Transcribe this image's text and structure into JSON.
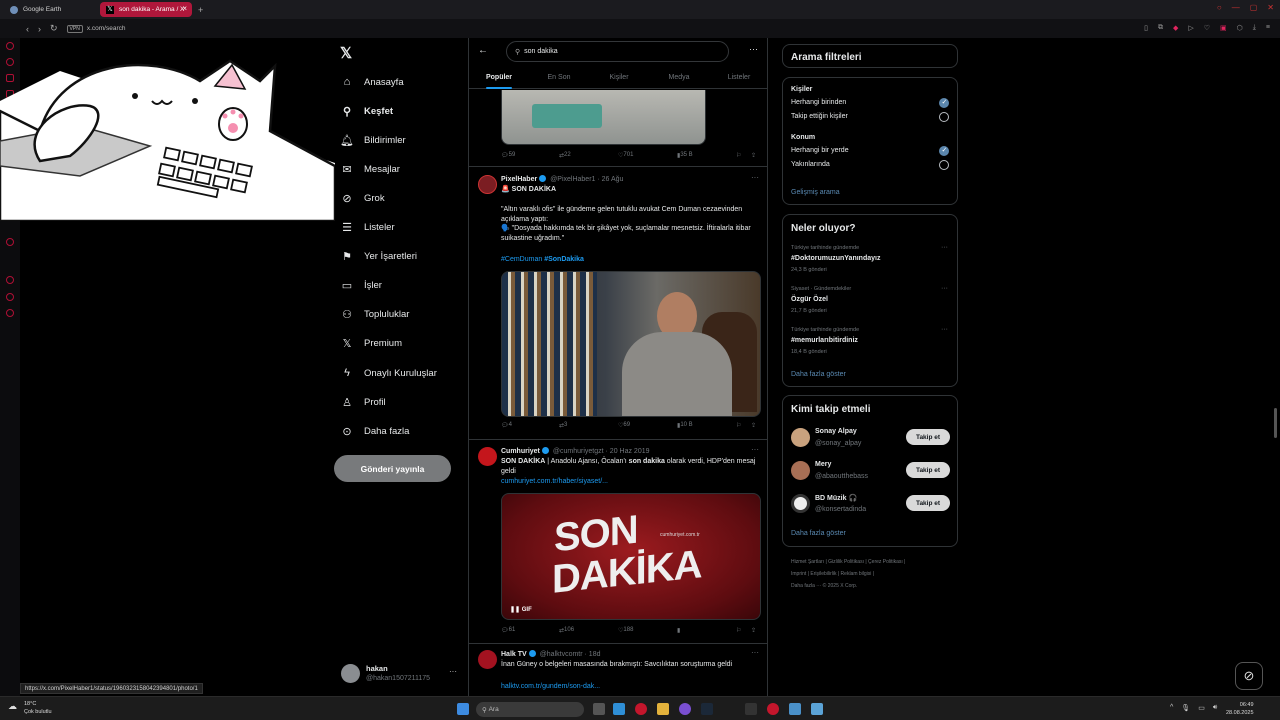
{
  "browser": {
    "tabs": [
      {
        "label": "Google Earth",
        "active": false
      },
      {
        "label": "son dakika - Arama / X",
        "active": true
      }
    ],
    "url": "x.com/search",
    "vpn_label": "VPN"
  },
  "nav": {
    "items": [
      {
        "label": "Anasayfa",
        "icon": "home-icon"
      },
      {
        "label": "Keşfet",
        "icon": "search-icon"
      },
      {
        "label": "Bildirimler",
        "icon": "bell-icon"
      },
      {
        "label": "Mesajlar",
        "icon": "mail-icon"
      },
      {
        "label": "Grok",
        "icon": "grok-icon"
      },
      {
        "label": "Listeler",
        "icon": "list-icon"
      },
      {
        "label": "Yer İşaretleri",
        "icon": "bookmark-icon"
      },
      {
        "label": "İşler",
        "icon": "briefcase-icon"
      },
      {
        "label": "Topluluklar",
        "icon": "people-icon"
      },
      {
        "label": "Premium",
        "icon": "x-logo-icon"
      },
      {
        "label": "Onaylı Kuruluşlar",
        "icon": "lightning-icon"
      },
      {
        "label": "Profil",
        "icon": "person-icon"
      },
      {
        "label": "Daha fazla",
        "icon": "more-circle-icon"
      }
    ],
    "post_button": "Gönderi yayınla",
    "account": {
      "name": "hakan",
      "handle": "@hakan1507211175"
    }
  },
  "search": {
    "query": "son dakika",
    "tabs": [
      "Popüler",
      "En Son",
      "Kişiler",
      "Medya",
      "Listeler"
    ],
    "active_tab": "Popüler"
  },
  "tweets": [
    {
      "actions": {
        "reply": "59",
        "retweet": "22",
        "like": "701",
        "views": "35 B"
      }
    },
    {
      "name": "PixelHaber",
      "handle": "@PixelHaber1 · 26 Ağu",
      "headline": "🚨 SON DAKİKA",
      "body": "\"Altın varaklı ofis\" ile gündeme gelen tutuklu avukat Cem Duman cezaevinden açıklama yaptı:",
      "quote": "🗣️ \"Dosyada hakkımda tek bir şikâyet yok, suçlamalar mesnetsiz. İftiralarla itibar suikastine uğradım.\"",
      "tag1": "#CemDuman",
      "tag2": "#SonDakika",
      "actions": {
        "reply": "4",
        "retweet": "3",
        "like": "69",
        "views": "10 B"
      }
    },
    {
      "name": "Cumhuriyet",
      "handle": "@cumhuriyetgzt · 20 Haz 2019",
      "body_prefix": "SON DAKİKA",
      "body_mid": " | Anadolu Ajansı, Öcalan'ı ",
      "body_bold": "son dakika",
      "body_suffix": " olarak verdi, HDP'den mesaj geldi",
      "link": "cumhuriyet.com.tr/haber/siyaset/...",
      "media_text_1": "SON",
      "media_text_2": "DAKİKA",
      "media_watermark": "cumhuriyet.com.tr",
      "gif_label": "GIF",
      "actions": {
        "reply": "61",
        "retweet": "106",
        "like": "188"
      }
    },
    {
      "name": "Halk TV",
      "handle": "@halktvcomtr · 18d",
      "body": "İnan Güney o belgeleri masasında bırakmıştı: Savcılıktan soruşturma geldi",
      "link": "halktv.com.tr/gundem/son-dak..."
    }
  ],
  "filters": {
    "title": "Arama filtreleri",
    "people_title": "Kişiler",
    "people_opts": [
      {
        "label": "Herhangi birinden",
        "selected": true
      },
      {
        "label": "Takip ettiğin kişiler",
        "selected": false
      }
    ],
    "location_title": "Konum",
    "location_opts": [
      {
        "label": "Herhangi bir yerde",
        "selected": true
      },
      {
        "label": "Yakınlarında",
        "selected": false
      }
    ],
    "advanced": "Gelişmiş arama"
  },
  "trends": {
    "title": "Neler oluyor?",
    "items": [
      {
        "meta": "Türkiye tarihinde gündemde",
        "name": "#DoktorumuzunYanındayız",
        "count": "24,3 B gönderi"
      },
      {
        "meta": "Siyaset · Gündemdekiler",
        "name": "Özgür Özel",
        "count": "21,7 B gönderi"
      },
      {
        "meta": "Türkiye tarihinde gündemde",
        "name": "#memurlarıbitirdiniz",
        "count": "18,4 B gönderi"
      }
    ],
    "more": "Daha fazla göster"
  },
  "who_to_follow": {
    "title": "Kimi takip etmeli",
    "items": [
      {
        "name": "Sonay Alpay",
        "handle": "@sonay_alpay",
        "button": "Takip et"
      },
      {
        "name": "Mery",
        "handle": "@abaoutthebass",
        "button": "Takip et"
      },
      {
        "name": "BD Müzik 🎧",
        "handle": "@konsertadinda",
        "button": "Takip et"
      }
    ],
    "more": "Daha fazla göster"
  },
  "footer": {
    "line1": "Hizmet Şartları  |  Gizlilik Politikası  |  Çerez Politikası  |",
    "line2": "Imprint  |  Erişilebilirlik  |  Reklam bilgisi  |",
    "line3": "Daha fazla ···  © 2025 X Corp."
  },
  "status_url": "https://x.com/PixelHaber1/status/1960323158042394801/photo/1",
  "taskbar": {
    "temp": "18°C",
    "weather": "Çok bulutlu",
    "search": "Ara",
    "time": "06:49",
    "date": "28.08.2025"
  }
}
